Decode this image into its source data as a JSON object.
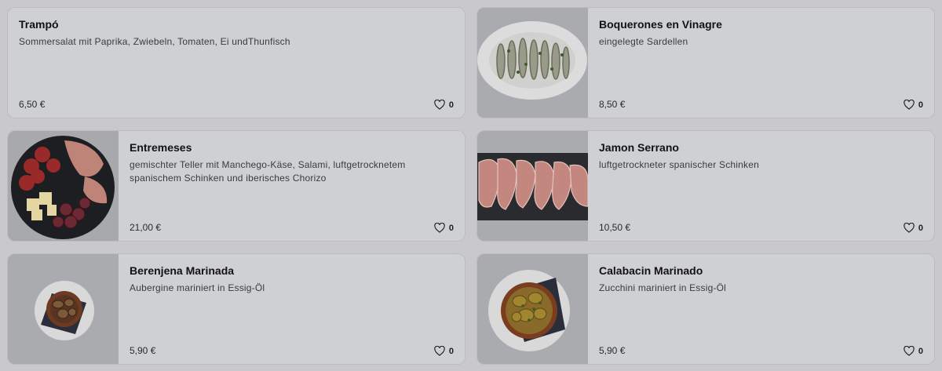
{
  "menu": {
    "items": [
      {
        "title": "Trampó",
        "description": "Sommersalat mit Paprika, Zwiebeln, Tomaten, Ei undThunfisch",
        "price": "6,50 €",
        "likes": "0",
        "image": "none"
      },
      {
        "title": "Boquerones en Vinagre",
        "description": "eingelegte Sardellen",
        "price": "8,50 €",
        "likes": "0",
        "image": "anchovies-plate"
      },
      {
        "title": "Entremeses",
        "description": "gemischter Teller mit Manchego-Käse, Salami, luftgetrocknetem spanischem Schinken und iberisches Chorizo",
        "price": "21,00 €",
        "likes": "0",
        "image": "charcuterie-plate"
      },
      {
        "title": "Jamon Serrano",
        "description": "luftgetrockneter spanischer Schinken",
        "price": "10,50 €",
        "likes": "0",
        "image": "ham-board"
      },
      {
        "title": "Berenjena Marinada",
        "description": "Aubergine mariniert in Essig-Öl",
        "price": "5,90 €",
        "likes": "0",
        "image": "eggplant-bowl"
      },
      {
        "title": "Calabacin Marinado",
        "description": "Zucchini mariniert in Essig-Öl",
        "price": "5,90 €",
        "likes": "0",
        "image": "zucchini-bowl"
      }
    ],
    "like_icon": "heart-outline-icon"
  }
}
